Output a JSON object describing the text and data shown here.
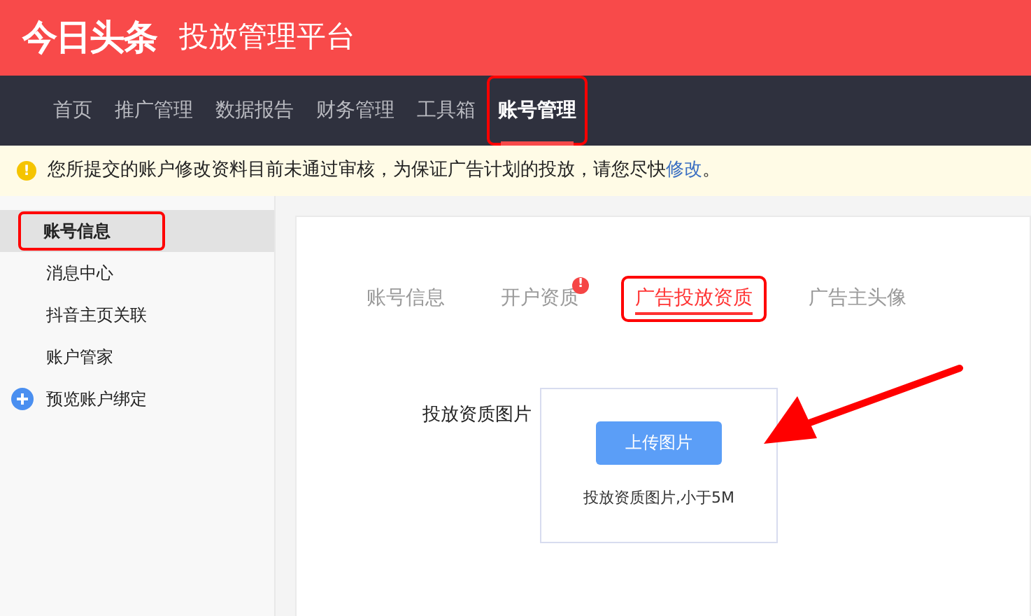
{
  "header": {
    "logo": "今日头条",
    "title": "投放管理平台"
  },
  "nav": [
    {
      "label": "首页",
      "selected": false,
      "highlighted": false
    },
    {
      "label": "推广管理",
      "selected": false,
      "highlighted": false
    },
    {
      "label": "数据报告",
      "selected": false,
      "highlighted": false
    },
    {
      "label": "财务管理",
      "selected": false,
      "highlighted": false
    },
    {
      "label": "工具箱",
      "selected": false,
      "highlighted": false
    },
    {
      "label": "账号管理",
      "selected": true,
      "highlighted": true
    }
  ],
  "alert": {
    "icon": "!",
    "text": "您所提交的账户修改资料目前未通过审核，为保证广告计划的投放，请您尽快",
    "link": "修改",
    "suffix": "。"
  },
  "sidebar": [
    {
      "label": "账号信息",
      "kind": "plain",
      "selected": true,
      "highlighted": true
    },
    {
      "label": "消息中心",
      "kind": "plain",
      "selected": false,
      "highlighted": false
    },
    {
      "label": "抖音主页关联",
      "kind": "plain",
      "selected": false,
      "highlighted": false
    },
    {
      "label": "账户管家",
      "kind": "plain",
      "selected": false,
      "highlighted": false
    },
    {
      "label": "预览账户绑定",
      "kind": "add",
      "selected": false,
      "highlighted": false
    }
  ],
  "tabs": [
    {
      "label": "账号信息",
      "selected": false,
      "highlighted": false
    },
    {
      "label": "开户资质",
      "selected": false,
      "highlighted": false,
      "badge": "!"
    },
    {
      "label": "广告投放资质",
      "selected": true,
      "highlighted": true
    },
    {
      "label": "广告主头像",
      "selected": false,
      "highlighted": false
    }
  ],
  "upload": {
    "label": "投放资质图片",
    "button": "上传图片",
    "hint": "投放资质图片,小于5M",
    "arrow": true
  }
}
